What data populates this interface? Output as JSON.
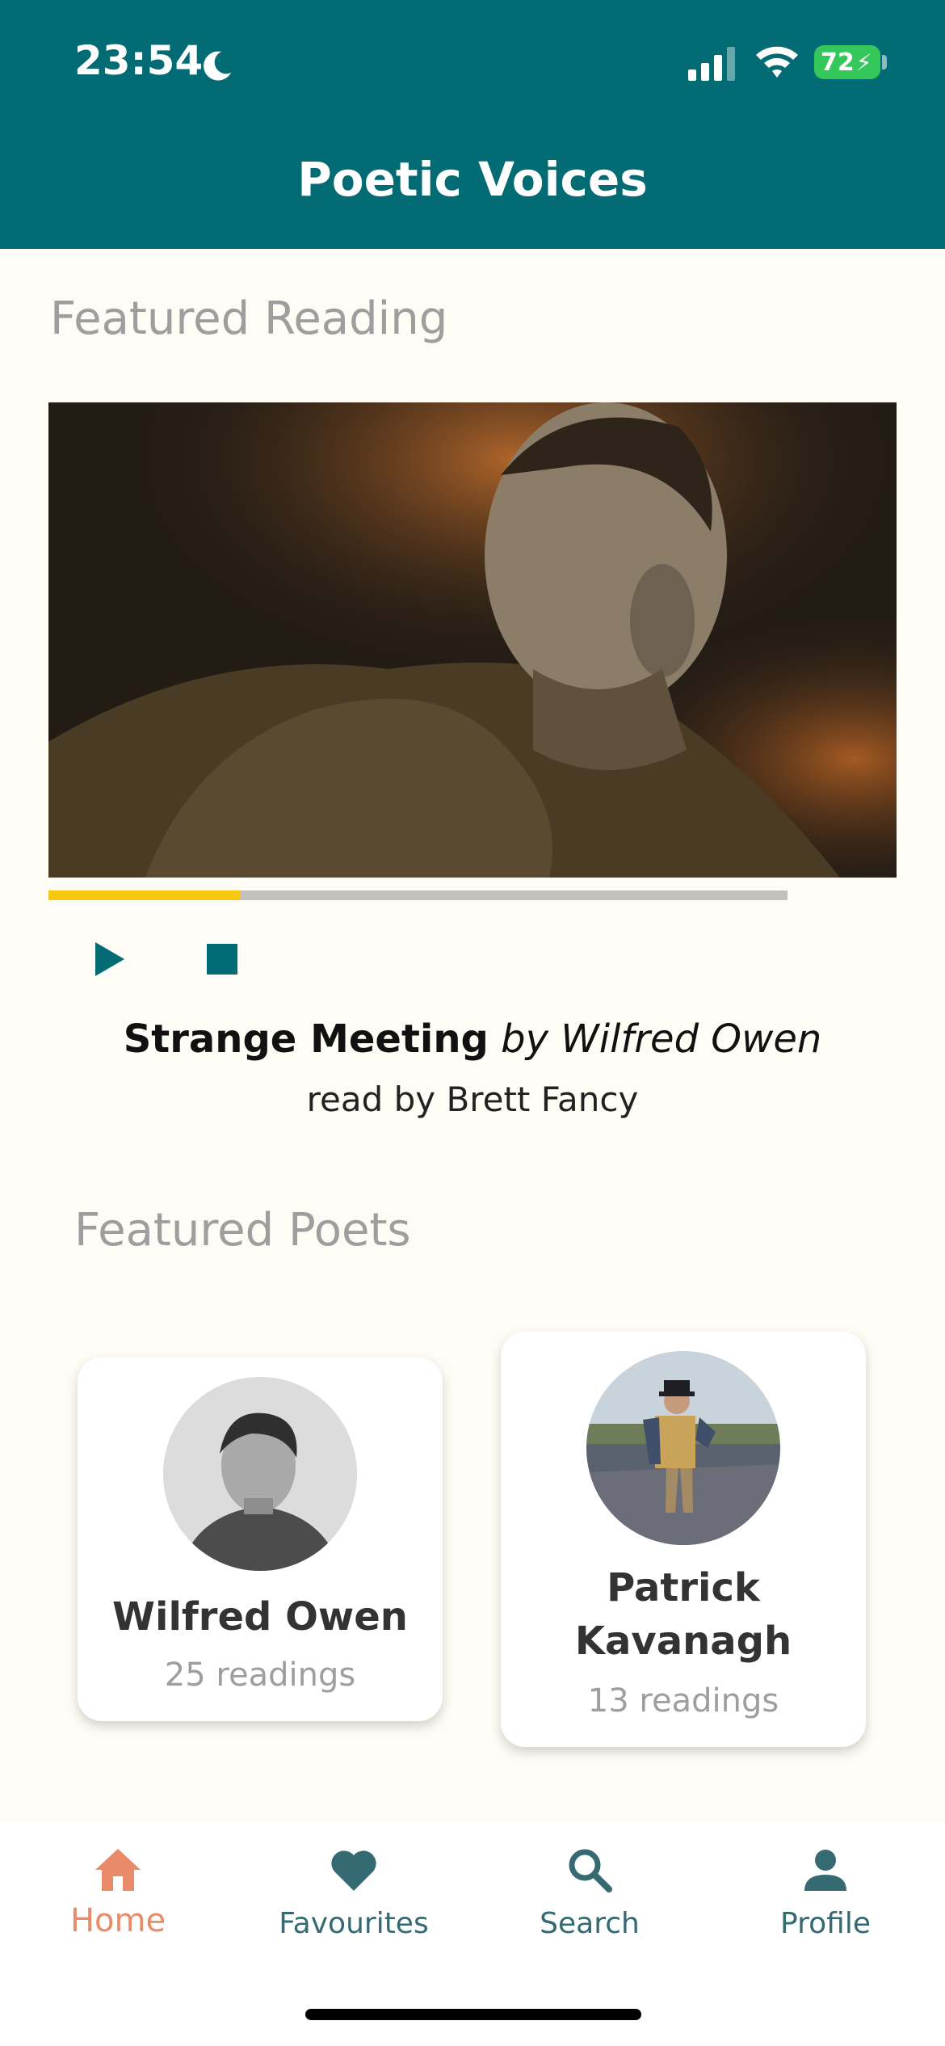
{
  "status_bar": {
    "time": "23:54",
    "battery_level": "72",
    "icons": [
      "moon-icon",
      "signal-icon",
      "wifi-icon",
      "battery-charging-icon"
    ]
  },
  "header": {
    "title": "Poetic Voices"
  },
  "featured_reading": {
    "section_title": "Featured Reading",
    "progress_fraction": 0.26,
    "poem_title": "Strange Meeting",
    "by_line": "by Wilfred Owen",
    "reader_line": "read by Brett Fancy",
    "controls": [
      "play-icon",
      "stop-icon"
    ]
  },
  "featured_poets": {
    "section_title": "Featured Poets",
    "poets": [
      {
        "name": "Wilfred Owen",
        "readings": "25 readings"
      },
      {
        "name_line1": "Patrick",
        "name_line2": "Kavanagh",
        "readings": "13 readings"
      }
    ]
  },
  "bottom_nav": {
    "active": "Home",
    "active_color": "#e98a68",
    "inactive_color": "#356a73",
    "items": [
      {
        "label": "Home",
        "icon": "home-icon"
      },
      {
        "label": "Favourites",
        "icon": "heart-icon"
      },
      {
        "label": "Search",
        "icon": "search-icon"
      },
      {
        "label": "Profile",
        "icon": "person-icon"
      }
    ]
  },
  "colors": {
    "header": "#036b73",
    "background": "#fffcf5",
    "progress_fill": "#f7c710",
    "progress_track": "#c4c0bd"
  }
}
